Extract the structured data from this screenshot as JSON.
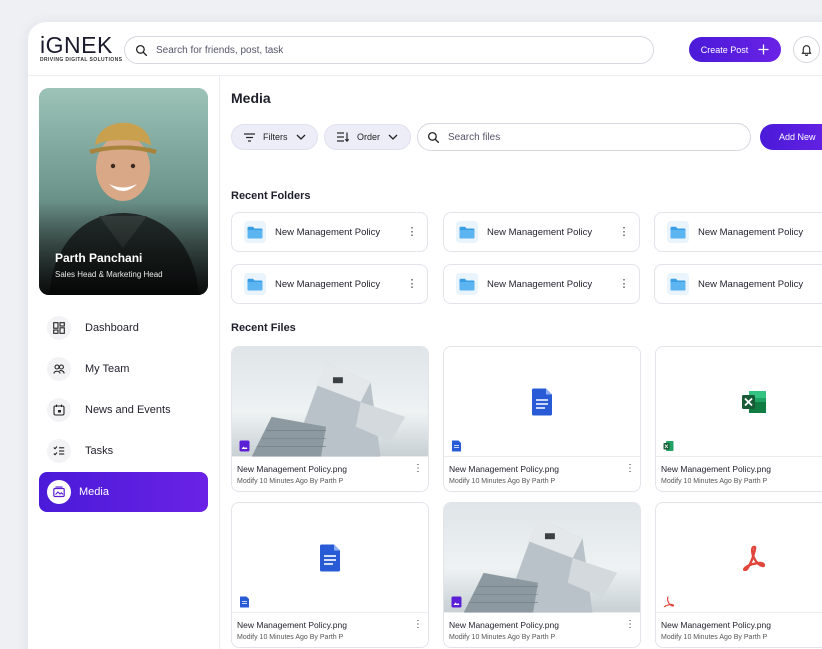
{
  "brand": {
    "name_main": "iGNEK",
    "tagline": "DRIVING DIGITAL SOLUTIONS"
  },
  "header": {
    "search_placeholder": "Search for friends, post, task",
    "create_label": "Create Post"
  },
  "profile": {
    "name": "Parth Panchani",
    "role": "Sales Head & Marketing Head"
  },
  "nav": [
    {
      "label": "Dashboard",
      "icon": "dashboard-icon"
    },
    {
      "label": "My Team",
      "icon": "team-icon"
    },
    {
      "label": "News and Events",
      "icon": "calendar-icon"
    },
    {
      "label": "Tasks",
      "icon": "tasks-icon"
    },
    {
      "label": "Media",
      "icon": "media-icon",
      "active": true
    }
  ],
  "main": {
    "title": "Media",
    "filters_label": "Filters",
    "order_label": "Order",
    "search_placeholder": "Search files",
    "add_label": "Add New",
    "recent_folders_title": "Recent Folders",
    "recent_files_title": "Recent Files",
    "folders": [
      "New Management Policy",
      "New Management Policy",
      "New Management Policy",
      "New Management Policy",
      "New Management Policy",
      "New Management Policy"
    ],
    "files": [
      {
        "name": "New Management Policy.png",
        "meta": "Modify 10 Minutes Ago By Parth P",
        "kind": "image"
      },
      {
        "name": "New Management Policy.png",
        "meta": "Modify 10 Minutes Ago By Parth P",
        "kind": "doc"
      },
      {
        "name": "New Management Policy.png",
        "meta": "Modify 10 Minutes Ago By Parth P",
        "kind": "excel"
      },
      {
        "name": "New Management Policy.png",
        "meta": "Modify 10 Minutes Ago By Parth P",
        "kind": "doc"
      },
      {
        "name": "New Management Policy.png",
        "meta": "Modify 10 Minutes Ago By Parth P",
        "kind": "image"
      },
      {
        "name": "New Management Policy.png",
        "meta": "Modify 10 Minutes Ago By Parth P",
        "kind": "pdf"
      }
    ]
  },
  "colors": {
    "accent": "#5b1fd6",
    "doc": "#2a5bd7",
    "excel": "#1d7a45",
    "pdf": "#e0463b",
    "folder": "#3a9ee4"
  }
}
